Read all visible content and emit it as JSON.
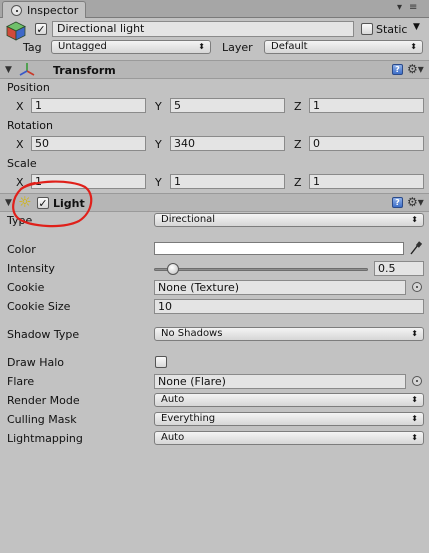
{
  "tab": {
    "title": "Inspector"
  },
  "object": {
    "name": "Directional light",
    "active": true,
    "static_label": "Static",
    "static_checked": false
  },
  "tag": {
    "label": "Tag",
    "value": "Untagged"
  },
  "layer": {
    "label": "Layer",
    "value": "Default"
  },
  "transform": {
    "title": "Transform",
    "position": {
      "label": "Position",
      "x": "1",
      "y": "5",
      "z": "1"
    },
    "rotation": {
      "label": "Rotation",
      "x": "50",
      "y": "340",
      "z": "0"
    },
    "scale": {
      "label": "Scale",
      "x": "1",
      "y": "1",
      "z": "1"
    },
    "axis": {
      "x": "X",
      "y": "Y",
      "z": "Z"
    }
  },
  "light": {
    "title": "Light",
    "enabled": true,
    "type": {
      "label": "Type",
      "value": "Directional"
    },
    "color": {
      "label": "Color",
      "value": "#ffffff"
    },
    "intensity": {
      "label": "Intensity",
      "value": "0.5",
      "fraction": 0.0625
    },
    "cookie": {
      "label": "Cookie",
      "value": "None (Texture)"
    },
    "cookie_size": {
      "label": "Cookie Size",
      "value": "10"
    },
    "shadow_type": {
      "label": "Shadow Type",
      "value": "No Shadows"
    },
    "draw_halo": {
      "label": "Draw Halo",
      "checked": false
    },
    "flare": {
      "label": "Flare",
      "value": "None (Flare)"
    },
    "render_mode": {
      "label": "Render Mode",
      "value": "Auto"
    },
    "culling_mask": {
      "label": "Culling Mask",
      "value": "Everything"
    },
    "lightmapping": {
      "label": "Lightmapping",
      "value": "Auto"
    }
  },
  "colors": {
    "panel": "#c2c2c2",
    "annotation": "#e0201a",
    "help_icon": "#3d6ec8"
  }
}
